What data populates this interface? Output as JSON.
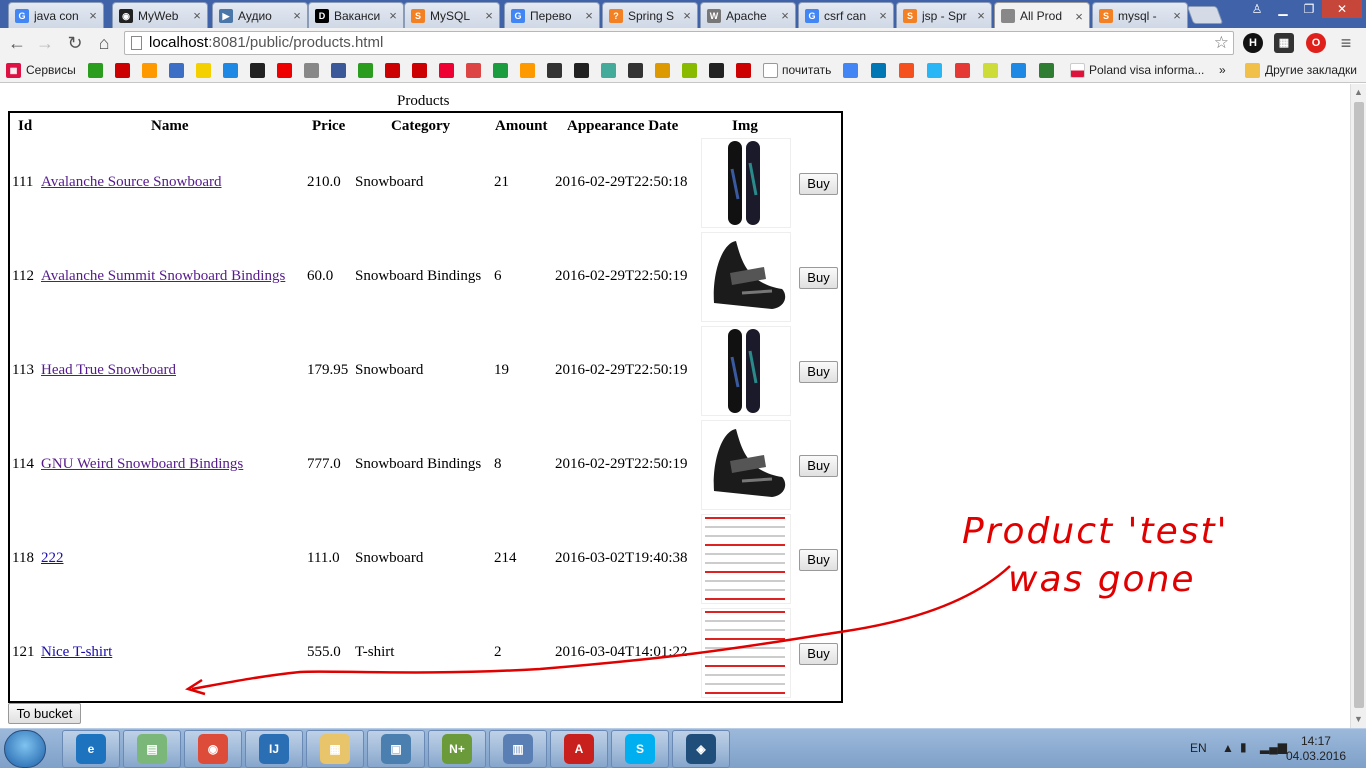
{
  "browser": {
    "tabs": [
      {
        "title": "java con",
        "icon": "google-icon",
        "color": "#4285f4",
        "glyph": "G"
      },
      {
        "title": "MyWeb",
        "icon": "github-icon",
        "color": "#222222",
        "glyph": "◉"
      },
      {
        "title": "Аудио",
        "icon": "vk-audio-icon",
        "color": "#4a76a8",
        "glyph": "▶"
      },
      {
        "title": "Ваканси",
        "icon": "dou-icon",
        "color": "#000000",
        "glyph": "D"
      },
      {
        "title": "MySQL",
        "icon": "stackoverflow-icon",
        "color": "#f48024",
        "glyph": "S"
      },
      {
        "title": "Перево",
        "icon": "google-translate-icon",
        "color": "#4285f4",
        "glyph": "G"
      },
      {
        "title": "Spring S",
        "icon": "stackoverflow-icon",
        "color": "#f48024",
        "glyph": "?"
      },
      {
        "title": "Apache",
        "icon": "wikipedia-icon",
        "color": "#777777",
        "glyph": "W"
      },
      {
        "title": "csrf can",
        "icon": "google-icon",
        "color": "#4285f4",
        "glyph": "G"
      },
      {
        "title": "jsp - Spr",
        "icon": "stackoverflow-icon",
        "color": "#f48024",
        "glyph": "S"
      },
      {
        "title": "All Prod",
        "icon": "page-icon",
        "color": "#888888",
        "glyph": ""
      },
      {
        "title": "mysql -",
        "icon": "stackoverflow-icon",
        "color": "#f48024",
        "glyph": "S"
      }
    ],
    "url_host": "localhost",
    "url_rest": ":8081/public/products.html",
    "bookmarks": {
      "apps_label": "Сервисы",
      "pochitat_label": "почитать",
      "poland_label": "Poland visa informa...",
      "more_label": "»",
      "other_label": "Другие закладки"
    }
  },
  "page": {
    "caption": "Products",
    "headers": {
      "id": "Id",
      "name": "Name",
      "price": "Price",
      "category": "Category",
      "amount": "Amount",
      "date": "Appearance Date",
      "img": "Img"
    },
    "rows": [
      {
        "id": "111",
        "name": "Avalanche Source Snowboard",
        "price": "210.0",
        "category": "Snowboard",
        "amount": "21",
        "date": "2016-02-29T22:50:18",
        "buy": "Buy",
        "img": "snowboard-image"
      },
      {
        "id": "112",
        "name": "Avalanche Summit Snowboard Bindings",
        "price": "60.0",
        "category": "Snowboard Bindings",
        "amount": "6",
        "date": "2016-02-29T22:50:19",
        "buy": "Buy",
        "img": "bindings-image"
      },
      {
        "id": "113",
        "name": "Head True Snowboard",
        "price": "179.95",
        "category": "Snowboard",
        "amount": "19",
        "date": "2016-02-29T22:50:19",
        "buy": "Buy",
        "img": "snowboard-image"
      },
      {
        "id": "114",
        "name": "GNU Weird Snowboard Bindings",
        "price": "777.0",
        "category": "Snowboard Bindings",
        "amount": "8",
        "date": "2016-02-29T22:50:19",
        "buy": "Buy",
        "img": "bindings-image"
      },
      {
        "id": "118",
        "name": "222",
        "price": "111.0",
        "category": "Snowboard",
        "amount": "214",
        "date": "2016-03-02T19:40:38",
        "buy": "Buy",
        "img": "document-image"
      },
      {
        "id": "121",
        "name": "Nice T-shirt",
        "price": "555.0",
        "category": "T-shirt",
        "amount": "2",
        "date": "2016-03-04T14:01:22",
        "buy": "Buy",
        "img": "document-image"
      }
    ],
    "bucket_button": "To bucket"
  },
  "annotation": {
    "line1": "Product 'test'",
    "line2": "was gone",
    "color": "#e00000"
  },
  "taskbar": {
    "apps": [
      "internet-explorer-icon",
      "notepad-icon",
      "chrome-icon",
      "intellij-icon",
      "file-explorer-icon",
      "photo-viewer-icon",
      "notepadpp-icon",
      "network-icon",
      "acrobat-icon",
      "skype-icon",
      "mysql-workbench-icon"
    ],
    "lang": "EN",
    "time": "14:17",
    "date": "04.03.2016"
  }
}
